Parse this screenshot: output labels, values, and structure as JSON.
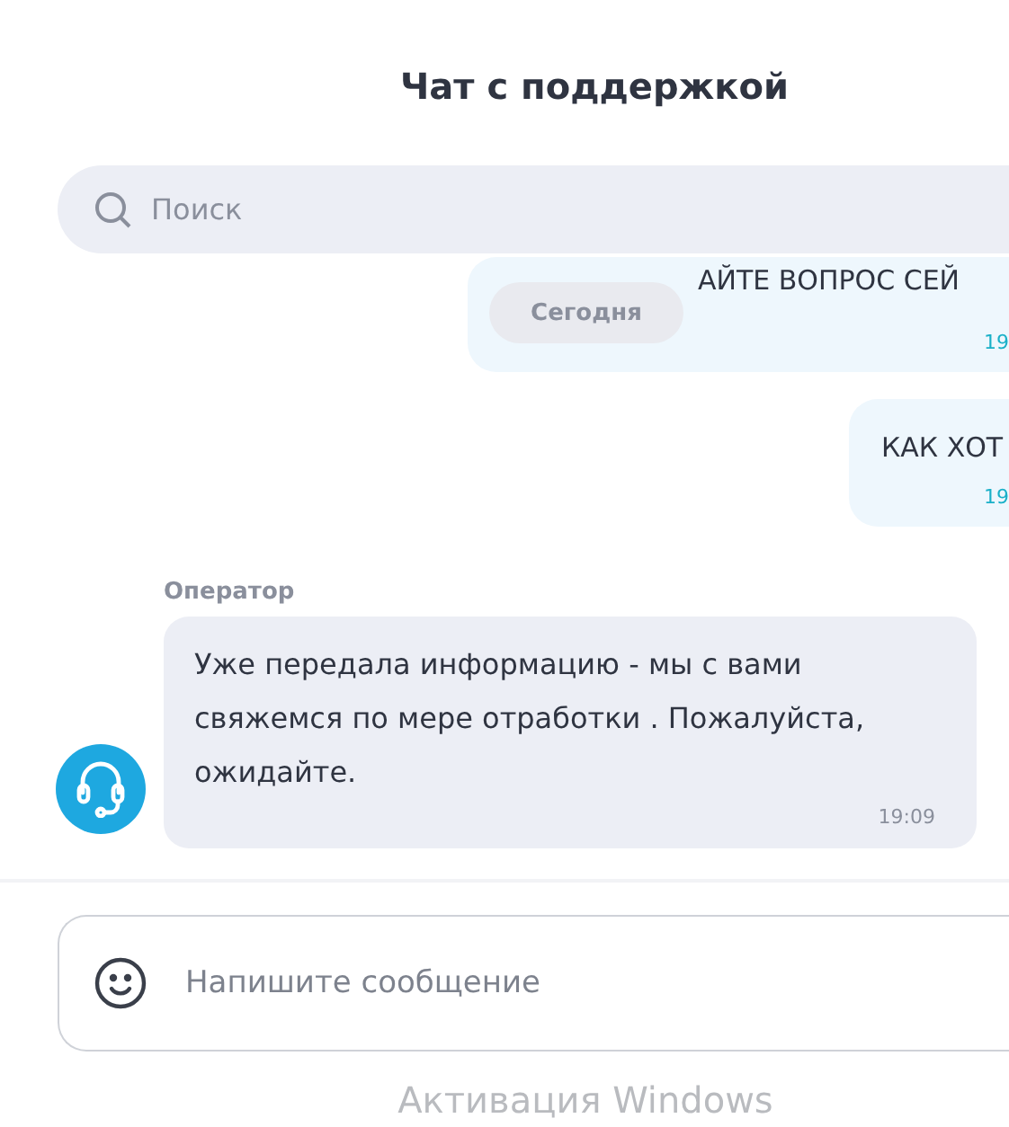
{
  "title": "Чат с поддержкой",
  "search": {
    "placeholder": "Поиск"
  },
  "date_chip": "Сегодня",
  "messages": [
    {
      "kind": "user",
      "text": "АЙТЕ ВОПРОС СЕЙ",
      "time": "19"
    },
    {
      "kind": "user",
      "text": "КАК ХОТ",
      "time": "19"
    },
    {
      "kind": "operator",
      "sender": "Оператор",
      "text": "Уже передала информацию - мы с вами свяжемся по мере отработки . Пожалуйста, ожидайте.",
      "time": "19:09"
    }
  ],
  "composer": {
    "placeholder": "Напишите сообщение"
  },
  "os_notice": "Активация Windows"
}
